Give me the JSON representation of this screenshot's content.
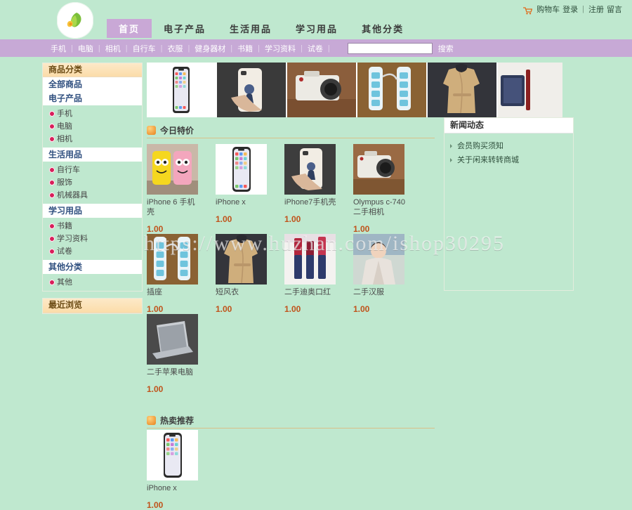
{
  "header": {
    "logo_alt": "leaf-logo",
    "account": {
      "cart": "购物车",
      "login": "登录",
      "divider": "|",
      "register": "注册",
      "message": "留言"
    },
    "tabs": [
      {
        "label": "首页",
        "active": true
      },
      {
        "label": "电子产品",
        "active": false
      },
      {
        "label": "生活用品",
        "active": false
      },
      {
        "label": "学习用品",
        "active": false
      },
      {
        "label": "其他分类",
        "active": false
      }
    ]
  },
  "subnav": {
    "links": [
      "手机",
      "电脑",
      "相机",
      "自行车",
      "衣服",
      "健身器材",
      "书籍",
      "学习资料",
      "试卷"
    ],
    "divider": "|",
    "search_value": "",
    "search_placeholder": "",
    "search_button": "搜索"
  },
  "sidebar": {
    "category_panel_title": "商品分类",
    "all_products": "全部商品",
    "groups": [
      {
        "title": "电子产品",
        "items": [
          "手机",
          "电脑",
          "相机"
        ]
      },
      {
        "title": "生活用品",
        "items": [
          "自行车",
          "服饰",
          "机械器具"
        ]
      },
      {
        "title": "学习用品",
        "items": [
          "书籍",
          "学习资料",
          "试卷"
        ]
      },
      {
        "title": "其他分类",
        "items": [
          "其他"
        ]
      }
    ],
    "recent_panel_title": "最近浏览"
  },
  "banner": {
    "slides": [
      "iphone-x",
      "phone-case-in-hand",
      "olympus-camera",
      "power-strips",
      "trench-coat",
      "laptop-partial"
    ]
  },
  "today_special": {
    "title": "今日特价",
    "icon": "clock-icon",
    "products": [
      {
        "name": "iPhone 6 手机壳",
        "price": "1.00",
        "image": "yellow-pink-phone-cases"
      },
      {
        "name": "iPhone x",
        "price": "1.00",
        "image": "iphone-x-front"
      },
      {
        "name": "iPhone7手机壳",
        "price": "1.00",
        "image": "white-phone-case-hand"
      },
      {
        "name": "Olympus c-740二手相机",
        "price": "1.00",
        "image": "olympus-camera"
      },
      {
        "name": "插座",
        "price": "1.00",
        "image": "power-strips"
      },
      {
        "name": "短风衣",
        "price": "1.00",
        "image": "trench-coat"
      },
      {
        "name": "二手迪奥口红",
        "price": "1.00",
        "image": "dior-lipsticks"
      },
      {
        "name": "二手汉服",
        "price": "1.00",
        "image": "hanfu-dress"
      },
      {
        "name": "二手苹果电脑",
        "price": "1.00",
        "image": "macbook-laptop"
      }
    ]
  },
  "news": {
    "title": "新闻动态",
    "items": [
      "会员购买须知",
      "关于闲来转转商城"
    ]
  },
  "hot_sale": {
    "title": "热卖推荐",
    "icon": "clock-icon",
    "products": [
      {
        "name": "iPhone x",
        "price": "1.00",
        "image": "iphone-x-front"
      }
    ]
  },
  "watermark": "https://www.huzhan.com/ishop30295",
  "colors": {
    "page_bg": "#bfe8cf",
    "subnav_purple": "#c7a9d6",
    "active_tab": "#c9a8d6",
    "price": "#c0521a",
    "panel_head": "#fbdca9"
  }
}
